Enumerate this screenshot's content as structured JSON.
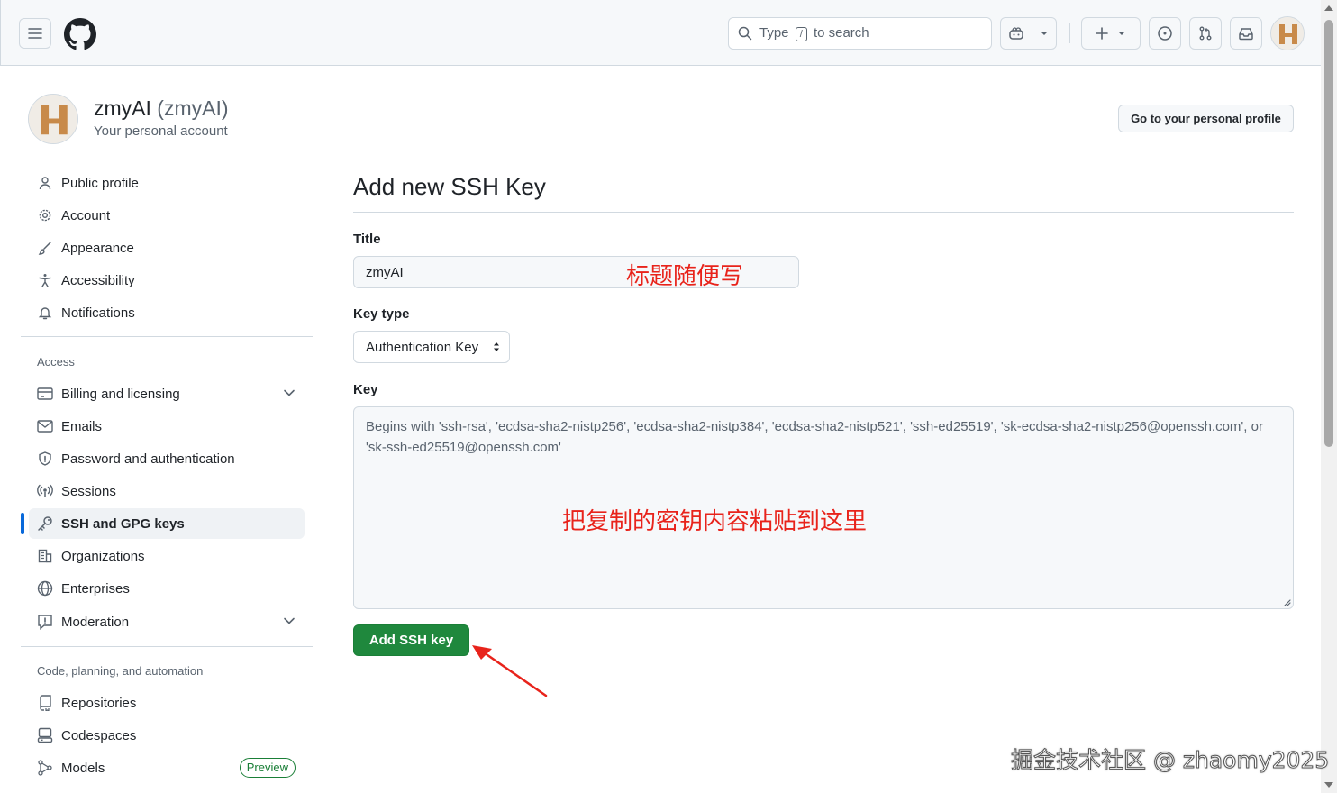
{
  "header": {
    "search_prefix": "Type",
    "search_key": "/",
    "search_suffix": "to search"
  },
  "profile": {
    "name": "zmyAI",
    "login": "(zmyAI)",
    "subtitle": "Your personal account",
    "go_profile_label": "Go to your personal profile"
  },
  "sidebar": {
    "items_top": [
      {
        "label": "Public profile",
        "icon": "person-icon"
      },
      {
        "label": "Account",
        "icon": "gear-icon"
      },
      {
        "label": "Appearance",
        "icon": "paintbrush-icon"
      },
      {
        "label": "Accessibility",
        "icon": "accessibility-icon"
      },
      {
        "label": "Notifications",
        "icon": "bell-icon"
      }
    ],
    "access_heading": "Access",
    "items_access": [
      {
        "label": "Billing and licensing",
        "icon": "credit-card-icon"
      },
      {
        "label": "Emails",
        "icon": "mail-icon"
      },
      {
        "label": "Password and authentication",
        "icon": "shield-icon"
      },
      {
        "label": "Sessions",
        "icon": "broadcast-icon"
      },
      {
        "label": "SSH and GPG keys",
        "icon": "key-icon"
      },
      {
        "label": "Organizations",
        "icon": "organization-icon"
      },
      {
        "label": "Enterprises",
        "icon": "globe-icon"
      },
      {
        "label": "Moderation",
        "icon": "report-icon"
      }
    ],
    "code_heading": "Code, planning, and automation",
    "items_code": [
      {
        "label": "Repositories",
        "icon": "repo-icon"
      },
      {
        "label": "Codespaces",
        "icon": "codespaces-icon"
      },
      {
        "label": "Models",
        "icon": "models-icon",
        "badge": "Preview"
      }
    ]
  },
  "form": {
    "page_title": "Add new SSH Key",
    "title_label": "Title",
    "title_value": "zmyAI",
    "key_type_label": "Key type",
    "key_type_value": "Authentication Key",
    "key_label": "Key",
    "key_placeholder": "Begins with 'ssh-rsa', 'ecdsa-sha2-nistp256', 'ecdsa-sha2-nistp384', 'ecdsa-sha2-nistp521', 'ssh-ed25519', 'sk-ecdsa-sha2-nistp256@openssh.com', or 'sk-ssh-ed25519@openssh.com'",
    "submit_label": "Add SSH key"
  },
  "annotations": {
    "title_hint": "标题随便写",
    "key_hint": "把复制的密钥内容粘贴到这里",
    "arrow_color": "#e8231b"
  },
  "watermark": "掘金技术社区 @ zhaomy2025",
  "colors": {
    "accent": "#0969da",
    "primary_button": "#1f883d",
    "annotation": "#e8231b"
  }
}
